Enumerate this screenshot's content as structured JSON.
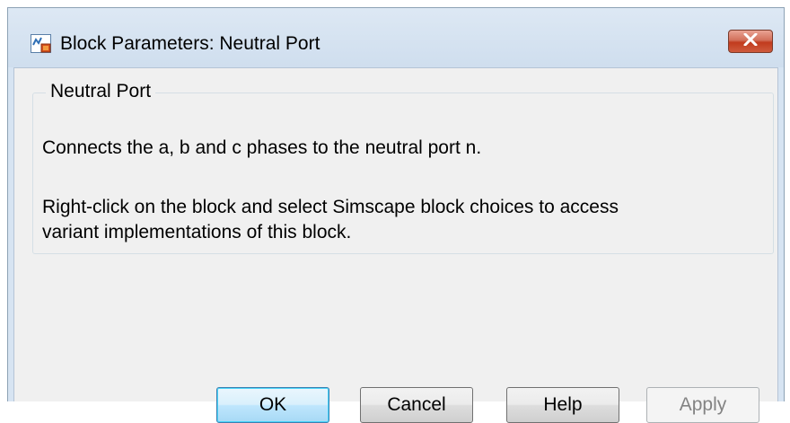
{
  "window": {
    "title": "Block Parameters: Neutral Port",
    "icon": "simulink-block-icon",
    "close_icon": "close-icon"
  },
  "group": {
    "legend": "Neutral Port",
    "description_line1": "Connects the a, b and c phases to the neutral port n.",
    "description_line2a": "Right-click on the block and select Simscape block choices to access",
    "description_line2b": "variant implementations of this block."
  },
  "buttons": {
    "ok": "OK",
    "cancel": "Cancel",
    "help": "Help",
    "apply": "Apply"
  },
  "colors": {
    "title_bar": "#cfdeee",
    "content_bg": "#f0f0f0",
    "close_button": "#c13b1e",
    "default_button_border": "#3c7fb1"
  }
}
